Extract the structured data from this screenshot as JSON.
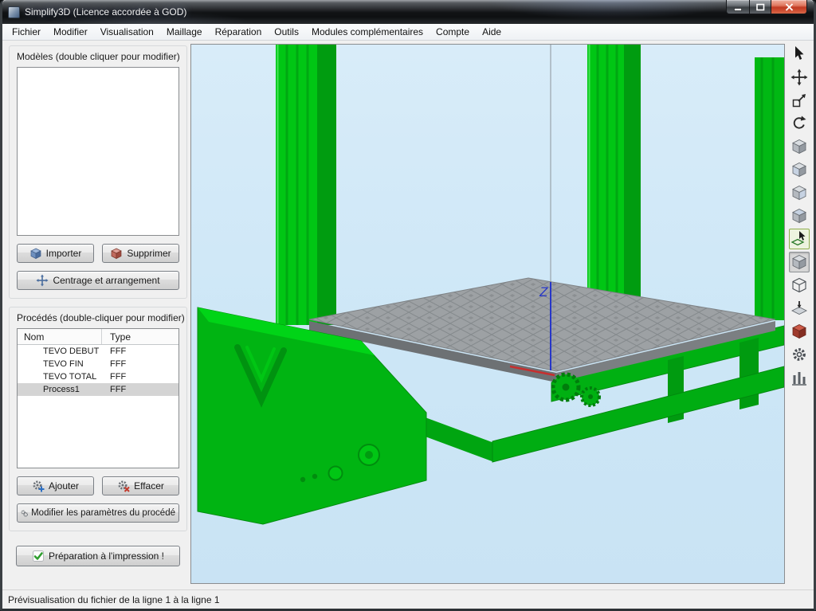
{
  "window": {
    "title": "Simplify3D (Licence accordée à GOD)"
  },
  "menu": {
    "items": [
      "Fichier",
      "Modifier",
      "Visualisation",
      "Maillage",
      "Réparation",
      "Outils",
      "Modules complémentaires",
      "Compte",
      "Aide"
    ]
  },
  "models_panel": {
    "title": "Modèles (double cliquer pour modifier)",
    "import_button": "Importer",
    "delete_button": "Supprimer",
    "center_button": "Centrage et arrangement"
  },
  "processes_panel": {
    "title": "Procédés (double-cliquer pour modifier)",
    "columns": {
      "name": "Nom",
      "type": "Type"
    },
    "rows": [
      {
        "name": "TEVO DEBUT",
        "type": "FFF",
        "selected": false
      },
      {
        "name": "TEVO FIN",
        "type": "FFF",
        "selected": false
      },
      {
        "name": "TEVO TOTAL",
        "type": "FFF",
        "selected": false
      },
      {
        "name": "Process1",
        "type": "FFF",
        "selected": true
      }
    ],
    "add_button": "Ajouter",
    "clear_button": "Effacer",
    "edit_button": "Modifier les paramètres du procédé",
    "prepare_button": "Préparation à l'impression !"
  },
  "viewport": {
    "z_axis_label": "Z",
    "background_color": "#cfe7f6",
    "printer_color": "#00c614",
    "bed_color": "#9da1a4"
  },
  "toolbar": {
    "tools": [
      "select",
      "translate",
      "scale",
      "rotate",
      "view-iso",
      "view-front",
      "view-side",
      "view-top",
      "select-model",
      "solid-view",
      "wireframe-view",
      "layer-view",
      "cross-section",
      "machine-settings",
      "support-structures"
    ]
  },
  "status_bar": {
    "text": "Prévisualisation du fichier de la ligne 1 à la ligne 1"
  }
}
